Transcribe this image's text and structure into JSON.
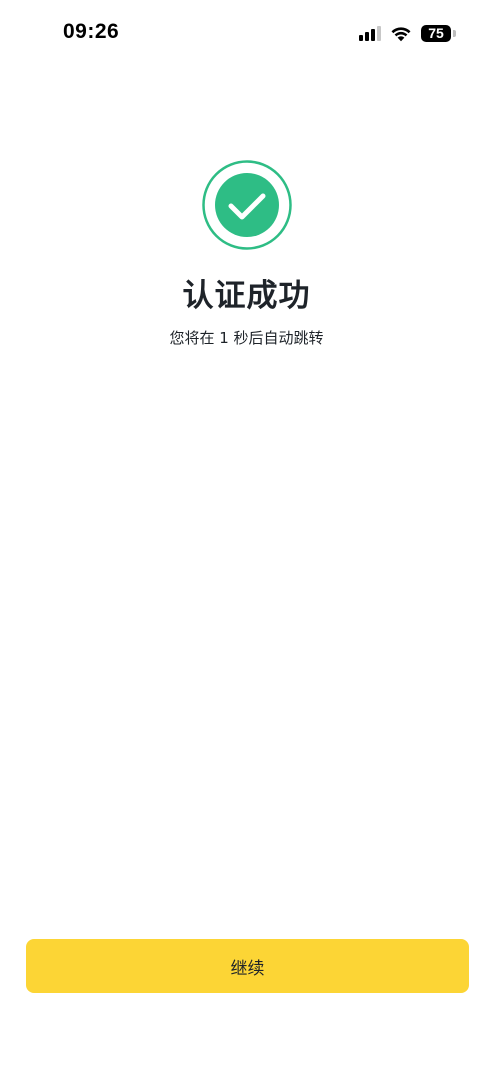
{
  "status_bar": {
    "time": "09:26",
    "battery_percent": "75",
    "signal_bars_active": 3,
    "signal_bars_total": 4,
    "icons": [
      "cellular-signal-icon",
      "wifi-icon",
      "battery-icon"
    ]
  },
  "result": {
    "icon": "check-circle-icon",
    "icon_color": "#2ebd85",
    "title": "认证成功",
    "subtitle": "您将在 1 秒后自动跳转"
  },
  "actions": {
    "continue_label": "继续",
    "continue_color": "#fcd535"
  }
}
